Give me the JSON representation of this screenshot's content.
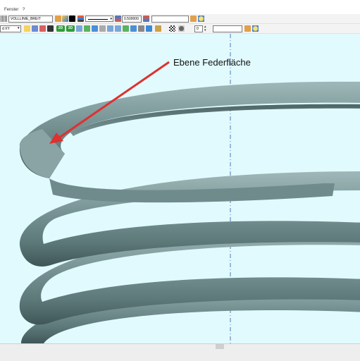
{
  "menu": {
    "items": [
      "Fenster",
      "?"
    ]
  },
  "toolbar1": {
    "linetype_value": "VOLLLINIE_BREIT",
    "lineweight_value": "0.500000",
    "color_value": "",
    "layer_value": ""
  },
  "toolbar2": {
    "view_value": "d XY",
    "btn_2d": "2D",
    "btn_3d": "3D",
    "step_value": "0",
    "search_value": ""
  },
  "viewport": {
    "annotation_label": "Ebene Federfläche",
    "spring_color": "#5f7f80",
    "background_color": "#e1fafd",
    "arrow_color": "#e03030",
    "axis_color": "#3355aa"
  }
}
